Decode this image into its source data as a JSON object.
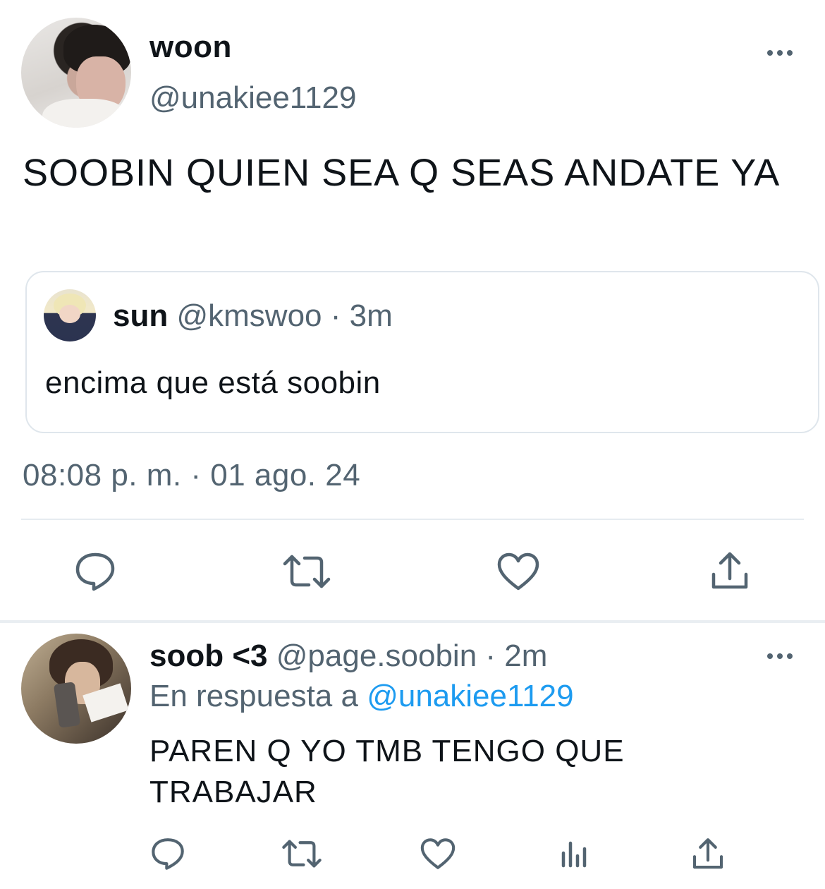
{
  "main_tweet": {
    "display_name": "woon",
    "handle": "@unakiee1129",
    "text": "SOOBIN QUIEN SEA Q SEAS ANDATE YA",
    "timestamp": "08:08 p. m. · 01 ago. 24",
    "quoted": {
      "display_name": "sun",
      "handle": "@kmswoo",
      "time": "· 3m",
      "text": "encima que está soobin"
    },
    "actions": [
      "reply-icon",
      "retweet-icon",
      "like-icon",
      "share-icon"
    ]
  },
  "reply_tweet": {
    "display_name": "soob <3",
    "handle": "@page.soobin",
    "time": "· 2m",
    "reply_prefix": "En respuesta a",
    "reply_to": "@unakiee1129",
    "text": "PAREN Q YO TMB TENGO QUE TRABAJAR",
    "actions": [
      "reply-icon",
      "retweet-icon",
      "like-icon",
      "analytics-icon",
      "share-icon"
    ]
  },
  "colors": {
    "text": "#0f1419",
    "secondary": "#536471",
    "link": "#1d9bf0",
    "border": "#dfe6ec"
  }
}
